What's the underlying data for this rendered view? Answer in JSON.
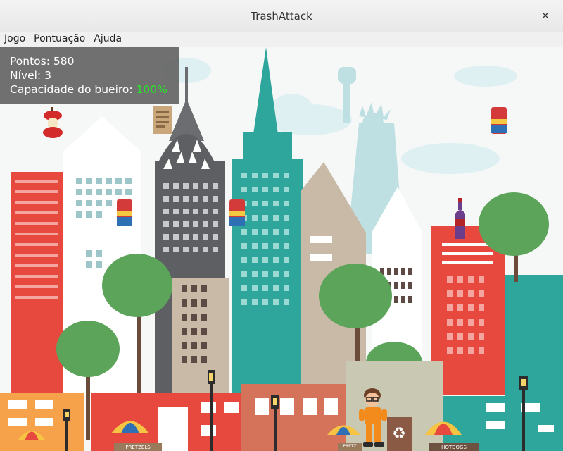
{
  "window": {
    "title": "TrashAttack",
    "close_glyph": "×"
  },
  "menu": {
    "items": [
      "Jogo",
      "Pontuação",
      "Ajuda"
    ]
  },
  "hud": {
    "points_label": "Pontos:",
    "points_value": "580",
    "level_label": "Nível:",
    "level_value": "3",
    "capacity_label": "Capacidade do bueiro:",
    "capacity_value": "100%",
    "capacity_color": "#27e52a"
  },
  "stands": {
    "pretzels": "PRETZELS",
    "pretzels2": "PRETZ",
    "hotdogs": "HOTDOGS"
  },
  "falling_items": [
    {
      "name": "apple-core",
      "icon": "apple-core-icon"
    },
    {
      "name": "paper-bag",
      "icon": "paper-icon"
    },
    {
      "name": "soda-can",
      "icon": "can-icon"
    },
    {
      "name": "soda-can",
      "icon": "can-icon"
    },
    {
      "name": "soda-can",
      "icon": "can-icon"
    },
    {
      "name": "soda-bottle",
      "icon": "bottle-icon"
    }
  ],
  "colors": {
    "sky": "#f6f8f7",
    "teal": "#2ea69c",
    "red": "#e8493f",
    "gray": "#5d5f62",
    "green": "#5ba45a"
  }
}
